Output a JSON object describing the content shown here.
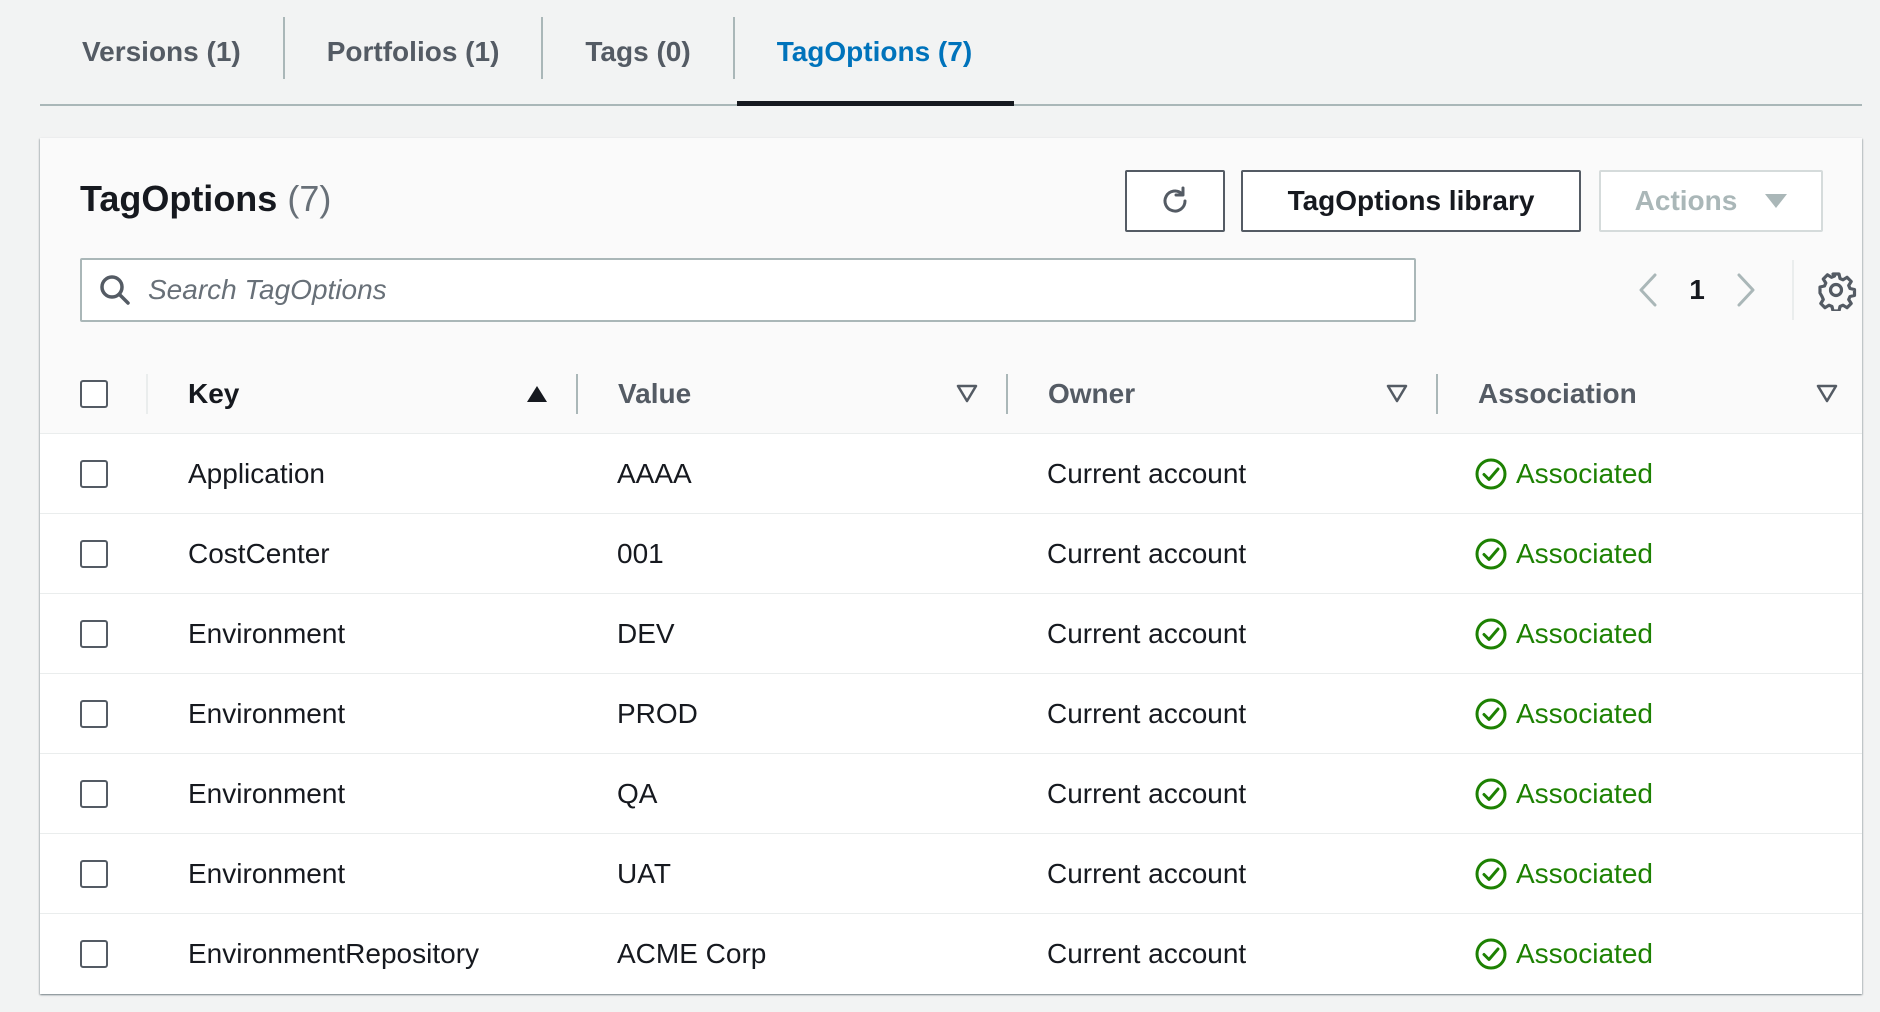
{
  "tabs": [
    {
      "label": "Versions (1)",
      "active": false
    },
    {
      "label": "Portfolios (1)",
      "active": false
    },
    {
      "label": "Tags (0)",
      "active": false
    },
    {
      "label": "TagOptions (7)",
      "active": true
    }
  ],
  "panel": {
    "title": "TagOptions",
    "count": "(7)",
    "library_button": "TagOptions library",
    "actions_button": "Actions"
  },
  "search": {
    "placeholder": "Search TagOptions",
    "value": ""
  },
  "pagination": {
    "current_page": "1"
  },
  "table": {
    "columns": [
      "Key",
      "Value",
      "Owner",
      "Association"
    ],
    "sorted_column": "Key",
    "sort_direction": "ascending",
    "rows": [
      {
        "key": "Application",
        "value": "AAAA",
        "owner": "Current account",
        "association": "Associated"
      },
      {
        "key": "CostCenter",
        "value": "001",
        "owner": "Current account",
        "association": "Associated"
      },
      {
        "key": "Environment",
        "value": "DEV",
        "owner": "Current account",
        "association": "Associated"
      },
      {
        "key": "Environment",
        "value": "PROD",
        "owner": "Current account",
        "association": "Associated"
      },
      {
        "key": "Environment",
        "value": "QA",
        "owner": "Current account",
        "association": "Associated"
      },
      {
        "key": "Environment",
        "value": "UAT",
        "owner": "Current account",
        "association": "Associated"
      },
      {
        "key": "EnvironmentRepository",
        "value": "ACME Corp",
        "owner": "Current account",
        "association": "Associated"
      }
    ]
  },
  "colors": {
    "active_tab": "#0073bb",
    "status_success": "#1d8102",
    "text_primary": "#16191f",
    "text_secondary": "#545b64",
    "disabled": "#aab7b8"
  },
  "icons": {
    "refresh": "refresh-icon",
    "search": "search-icon",
    "prev": "chevron-left-icon",
    "next": "chevron-right-icon",
    "settings": "gear-icon",
    "status": "check-circle-icon",
    "sort_asc": "caret-up-filled-icon",
    "sort_none": "caret-down-outline-icon",
    "dropdown": "caret-down-icon"
  }
}
